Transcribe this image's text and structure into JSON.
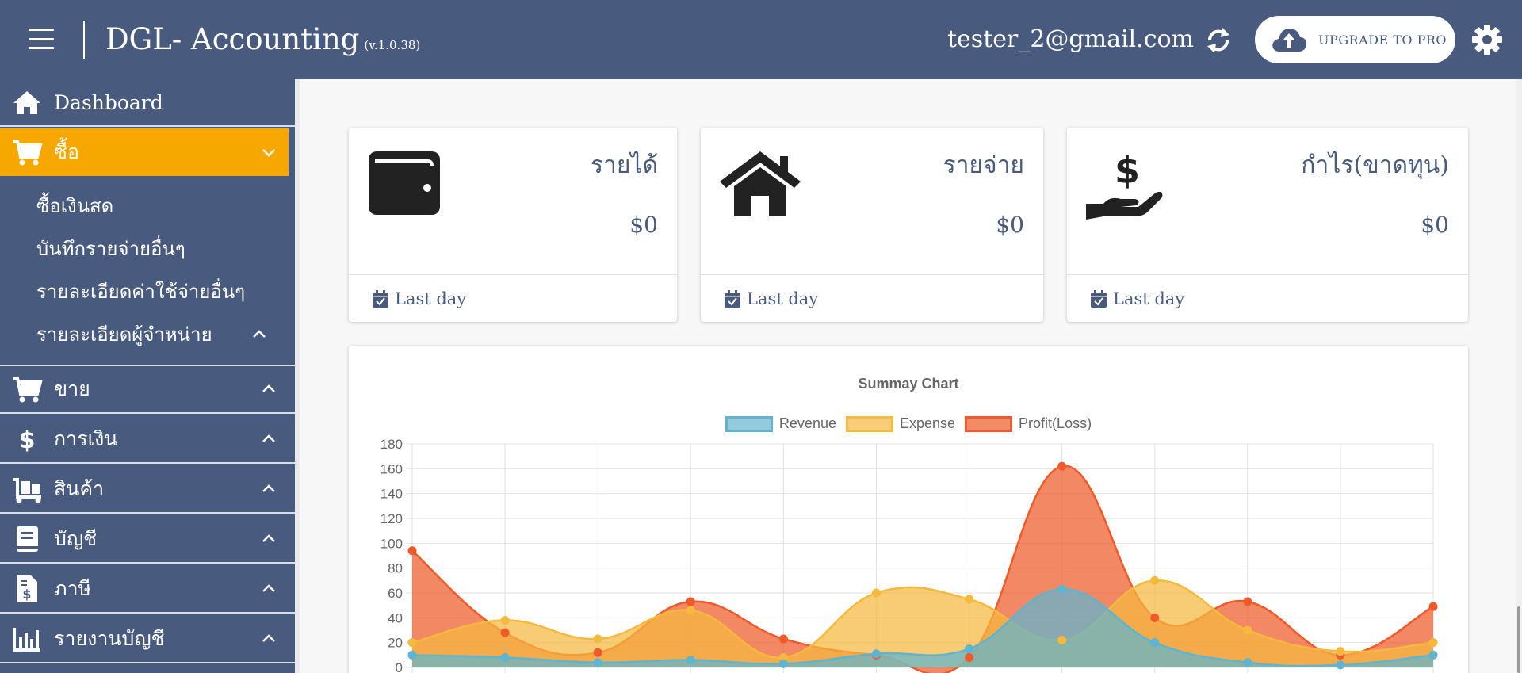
{
  "header": {
    "brand": "DGL- Accounting",
    "version": "(v.1.0.38)",
    "user_email": "tester_2@gmail.com",
    "upgrade_label": "UPGRADE TO PRO"
  },
  "sidebar": {
    "dashboard": "Dashboard",
    "purchase": "ซื้อ",
    "purchase_sub": [
      "ซื้อเงินสด",
      "บันทึกรายจ่ายอื่นๆ",
      "รายละเอียดค่าใช้จ่ายอื่นๆ",
      "รายละเอียดผู้จำหน่าย"
    ],
    "sell": "ขาย",
    "finance": "การเงิน",
    "products": "สินค้า",
    "accounts": "บัญชี",
    "tax": "ภาษี",
    "reports": "รายงานบัญชี"
  },
  "cards": [
    {
      "title": "รายได้",
      "value": "$0",
      "footer": "Last day",
      "icon": "wallet-icon"
    },
    {
      "title": "รายจ่าย",
      "value": "$0",
      "footer": "Last day",
      "icon": "home-icon"
    },
    {
      "title": "กำไร(ขาดทุน)",
      "value": "$0",
      "footer": "Last day",
      "icon": "hand-dollar-icon"
    }
  ],
  "colors": {
    "header_bg": "#485a7e",
    "active_item": "#f6a800",
    "revenue": "#5fb4cf",
    "expense": "#f5b93e",
    "profit": "#ef5a2a"
  },
  "chart_data": {
    "type": "area",
    "title": "Summay Chart",
    "legend_position": "top",
    "grid": true,
    "ylim": [
      0,
      180
    ],
    "y_ticks": [
      0,
      20,
      40,
      60,
      80,
      100,
      120,
      140,
      160,
      180
    ],
    "series": [
      {
        "name": "Revenue",
        "values": [
          10,
          8,
          4,
          6,
          3,
          11,
          15,
          63,
          20,
          4,
          2,
          10
        ]
      },
      {
        "name": "Expense",
        "values": [
          20,
          38,
          23,
          46,
          8,
          60,
          55,
          22,
          70,
          30,
          13,
          20
        ]
      },
      {
        "name": "Profit(Loss)",
        "values": [
          94,
          28,
          12,
          53,
          23,
          10,
          8,
          162,
          40,
          53,
          10,
          49
        ]
      }
    ]
  }
}
